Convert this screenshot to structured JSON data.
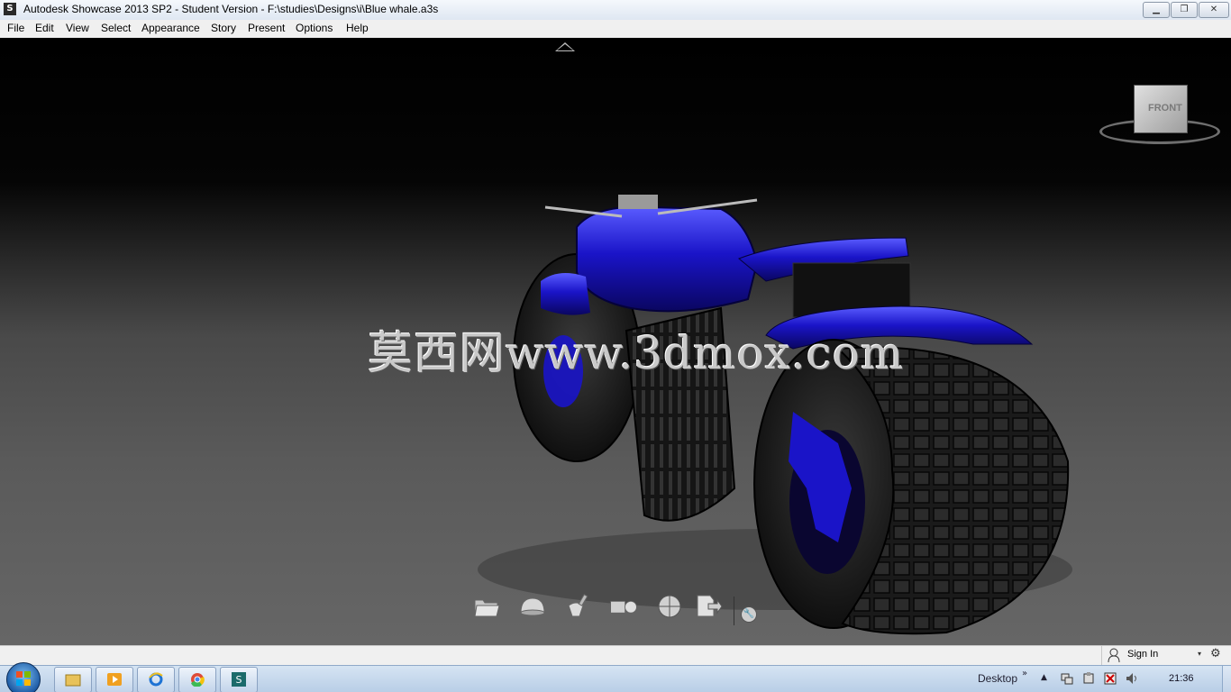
{
  "window": {
    "title": "Autodesk Showcase 2013 SP2 - Student Version - F:\\studies\\Designs\\i\\Blue whale.a3s",
    "app_icon_letter": "S",
    "minimize": "▁",
    "maximize": "❐",
    "close": "✕"
  },
  "menu": {
    "items": [
      "File",
      "Edit",
      "View",
      "Select",
      "Appearance",
      "Story",
      "Present",
      "Options",
      "Help"
    ]
  },
  "viewport": {
    "viewcube_label": "FRONT",
    "watermark": "莫西网www.3dmox.com",
    "body_color": "#1a14c8",
    "tire_color": "#141414"
  },
  "toolbar": {
    "tools": [
      "folder-open-icon",
      "environment-dome-icon",
      "material-brush-icon",
      "camera-views-icon",
      "lighting-sphere-icon",
      "export-icon"
    ],
    "settings_glyph": "🔧"
  },
  "status": {
    "sign_in": "Sign In",
    "dropdown_glyph": "▾",
    "help_glyph": "⚙"
  },
  "taskbar": {
    "desktop_label": "Desktop",
    "chevron": "»",
    "tray_up": "▲",
    "clock": "21:36"
  }
}
